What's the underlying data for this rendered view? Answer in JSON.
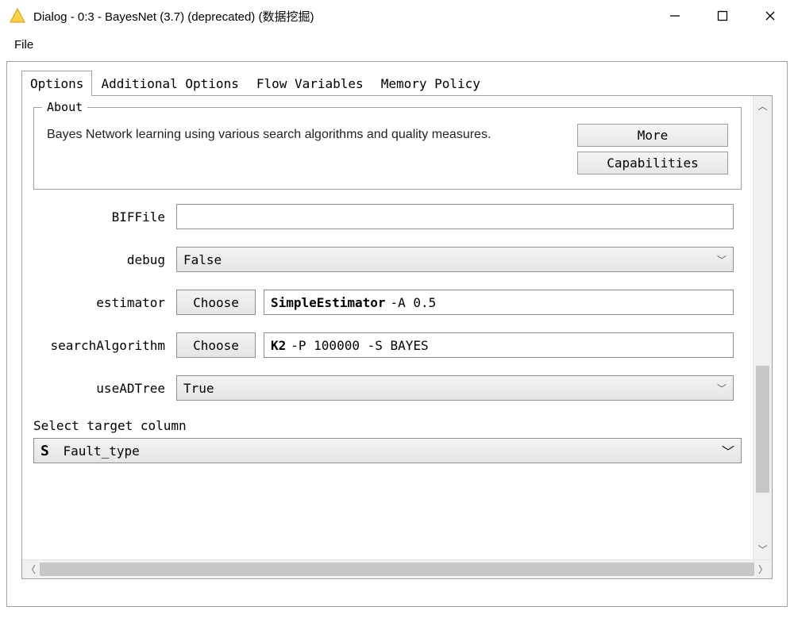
{
  "window": {
    "title": "Dialog - 0:3 - BayesNet (3.7) (deprecated) (数据挖掘)"
  },
  "menubar": {
    "file": "File"
  },
  "tabs": [
    {
      "label": "Options",
      "active": true
    },
    {
      "label": "Additional Options",
      "active": false
    },
    {
      "label": "Flow Variables",
      "active": false
    },
    {
      "label": "Memory Policy",
      "active": false
    }
  ],
  "about": {
    "legend": "About",
    "text": "Bayes Network learning using various search algorithms and quality measures.",
    "more_label": "More",
    "capabilities_label": "Capabilities"
  },
  "options": {
    "biffile": {
      "label": "BIFFile",
      "value": ""
    },
    "debug": {
      "label": "debug",
      "value": "False"
    },
    "estimator": {
      "label": "estimator",
      "choose_label": "Choose",
      "name": "SimpleEstimator",
      "args": "-A 0.5"
    },
    "searchAlgorithm": {
      "label": "searchAlgorithm",
      "choose_label": "Choose",
      "name": "K2",
      "args": "-P 100000 -S BAYES"
    },
    "useADTree": {
      "label": "useADTree",
      "value": "True"
    }
  },
  "target": {
    "label": "Select target column",
    "type_badge": "S",
    "value": "Fault_type"
  }
}
